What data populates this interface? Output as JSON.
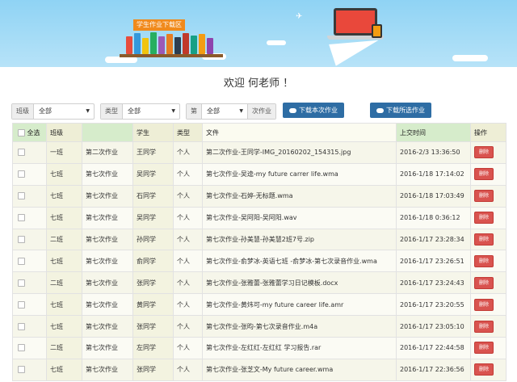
{
  "banner": {
    "title": "学生作业下载区"
  },
  "welcome": "欢迎 何老师 ！",
  "filters": {
    "class_label": "班级",
    "class_value": "全部",
    "type_label": "类型",
    "type_value": "全部",
    "assignment_prefix": "第",
    "assignment_value": "全部",
    "assignment_suffix": "次作业",
    "download_current_label": "下载本次作业",
    "download_selected_label": "下载所选作业"
  },
  "table": {
    "headers": {
      "select_all": "全选",
      "class": "班级",
      "assignment": "",
      "student": "学生",
      "type": "类型",
      "file": "文件",
      "upload_time": "上交时间",
      "action": "操作"
    },
    "delete_label": "删除",
    "rows": [
      {
        "class": "一班",
        "assignment": "第二次作业",
        "student": "王同学",
        "type": "个人",
        "file": "第二次作业-王同学-IMG_20160202_154315.jpg",
        "time": "2016-2/3 13:36:50"
      },
      {
        "class": "七班",
        "assignment": "第七次作业",
        "student": "吴同学",
        "type": "个人",
        "file": "第七次作业-吴逵-my future carrer life.wma",
        "time": "2016-1/18 17:14:02"
      },
      {
        "class": "七班",
        "assignment": "第七次作业",
        "student": "石同学",
        "type": "个人",
        "file": "第七次作业-石婷-无标题.wma",
        "time": "2016-1/18 17:03:49"
      },
      {
        "class": "七班",
        "assignment": "第七次作业",
        "student": "吴同学",
        "type": "个人",
        "file": "第七次作业-吴阿阳-吴阿阳.wav",
        "time": "2016-1/18 0:36:12"
      },
      {
        "class": "二班",
        "assignment": "第七次作业",
        "student": "孙同学",
        "type": "个人",
        "file": "第七次作业-孙美慧-孙美慧2班7号.zip",
        "time": "2016-1/17 23:28:34"
      },
      {
        "class": "七班",
        "assignment": "第七次作业",
        "student": "俞同学",
        "type": "个人",
        "file": "第七次作业-俞梦冰-英语七班 -俞梦冰-第七次录音作业.wma",
        "time": "2016-1/17 23:26:51"
      },
      {
        "class": "二班",
        "assignment": "第七次作业",
        "student": "张同学",
        "type": "个人",
        "file": "第七次作业-张雅蕾-张雅蕾学习日记模板.docx",
        "time": "2016-1/17 23:24:43"
      },
      {
        "class": "七班",
        "assignment": "第七次作业",
        "student": "黄同学",
        "type": "个人",
        "file": "第七次作业-黄炜可-my future career life.amr",
        "time": "2016-1/17 23:20:55"
      },
      {
        "class": "七班",
        "assignment": "第七次作业",
        "student": "张同学",
        "type": "个人",
        "file": "第七次作业-张昀-第七次录音作业.m4a",
        "time": "2016-1/17 23:05:10"
      },
      {
        "class": "二班",
        "assignment": "第七次作业",
        "student": "左同学",
        "type": "个人",
        "file": "第七次作业-左红红-左红红 学习报告.rar",
        "time": "2016-1/17 22:44:58"
      },
      {
        "class": "七班",
        "assignment": "第七次作业",
        "student": "张同学",
        "type": "个人",
        "file": "第七次作业-张芝文-My future career.wma",
        "time": "2016-1/17 22:36:56"
      }
    ]
  },
  "colors": {
    "accent_blue": "#2e6da4",
    "delete_red": "#d9534f",
    "header_green": "#d6eccb",
    "header_cream": "#eeeed6",
    "banner_sky": "#9dd8f5"
  }
}
